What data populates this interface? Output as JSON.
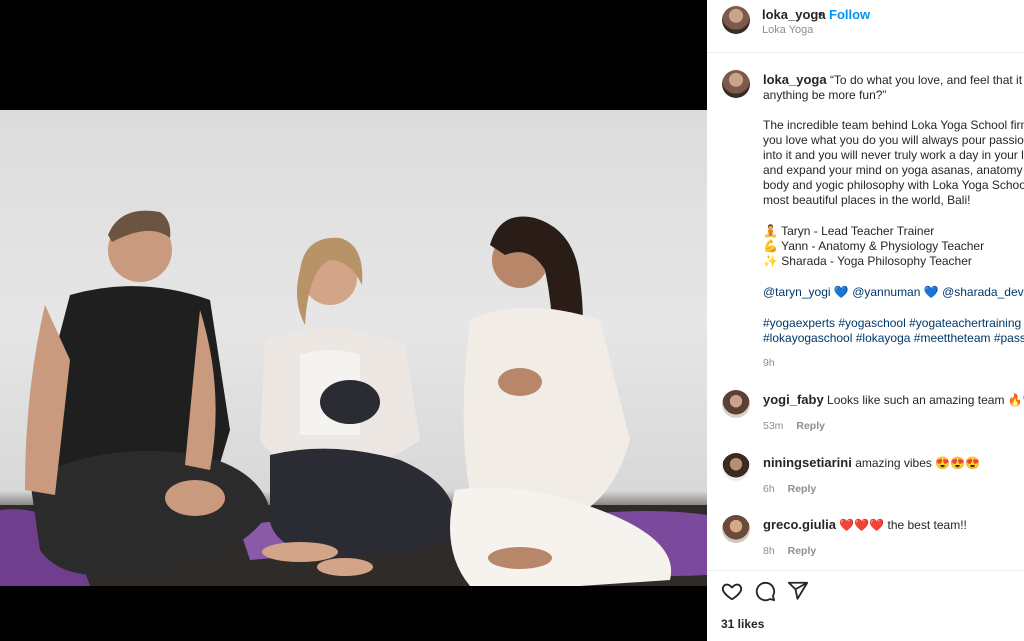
{
  "header": {
    "username": "loka_yoga",
    "separator": "•",
    "follow_label": "Follow",
    "location": "Loka Yoga"
  },
  "caption": {
    "username": "loka_yoga",
    "lines": [
      "“To do what you love, and feel that it ma",
      "anything be more fun?”",
      "The incredible team behind Loka Yoga School firmly",
      "you love what you do you will always pour passion",
      "into it and you will never truly work a day in your l",
      "and expand your mind on yoga asanas, anatomy o",
      "body and yogic philosophy with Loka Yoga School",
      "most beautiful places in the world, Bali!"
    ],
    "team": [
      {
        "icon": "🧘",
        "text": "Taryn - Lead Teacher Trainer"
      },
      {
        "icon": "💪",
        "text": "Yann - Anatomy & Physiology Teacher"
      },
      {
        "icon": "✨",
        "text": "Sharada - Yoga Philosophy Teacher"
      }
    ],
    "mentions": [
      "@taryn_yogi",
      "💙",
      "@yannuman",
      "💙",
      "@sharada_devi_"
    ],
    "hashtags_line1": "#yogaexperts #yogaschool #yogateachertraining #",
    "hashtags_line2": "#lokayogaschool #lokayoga #meettheteam #passio",
    "time": "9h"
  },
  "comments": [
    {
      "username": "yogi_faby",
      "text": "Looks like such an amazing team",
      "emoji": "🔥❤️",
      "time": "53m",
      "reply": "Reply"
    },
    {
      "username": "niningsetiarini",
      "text": "amazing vibes",
      "emoji": "😍😍😍",
      "time": "6h",
      "reply": "Reply"
    },
    {
      "username": "greco.giulia",
      "emoji_before": "❤️❤️❤️",
      "text": "the best team!!",
      "time": "8h",
      "reply": "Reply"
    }
  ],
  "likes": "31 likes",
  "icons": {
    "like": "heart-icon",
    "comment": "comment-icon",
    "share": "share-icon"
  },
  "colors": {
    "follow": "#0095f6",
    "link": "#00376b",
    "muted": "#8e8e8e",
    "mat": "#7b4a9c"
  }
}
